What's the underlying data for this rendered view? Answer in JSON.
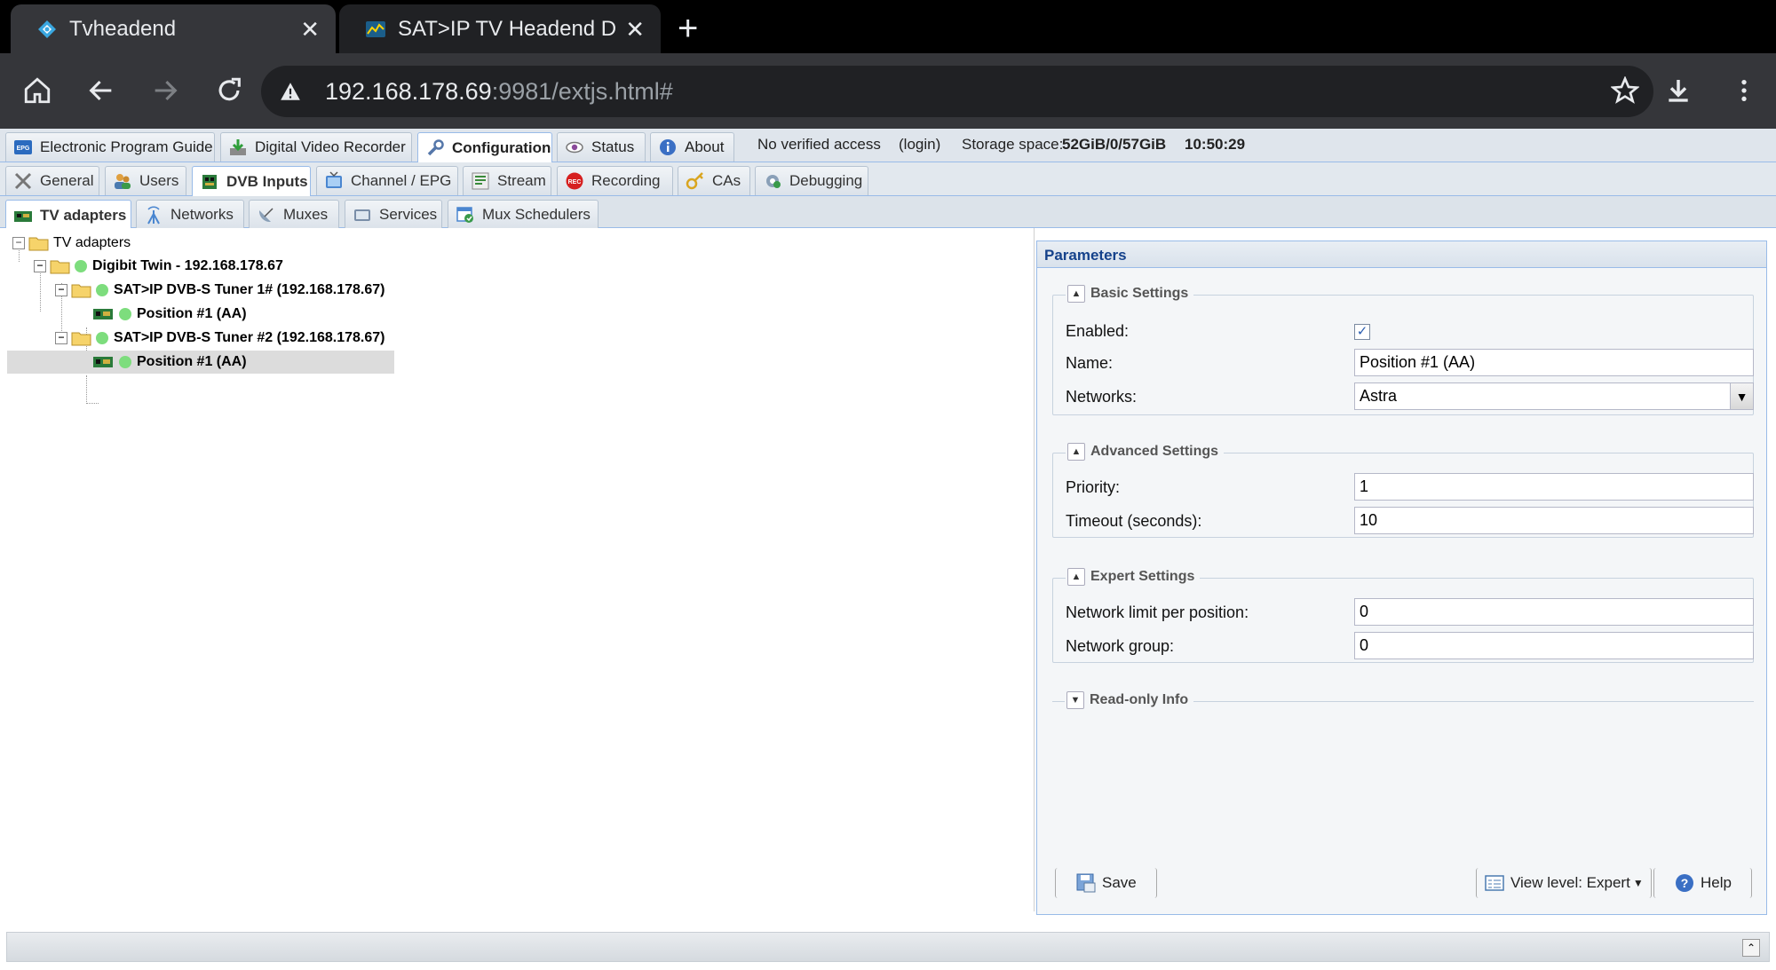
{
  "browser": {
    "tabs": [
      {
        "title": "Tvheadend",
        "active": true
      },
      {
        "title": "SAT>IP TV Headend DVB-",
        "active": false
      }
    ],
    "url_host": "192.168.178.69",
    "url_path": ":9981/extjs.html#"
  },
  "main_tabs": [
    {
      "label": "Electronic Program Guide",
      "icon": "epg-icon"
    },
    {
      "label": "Digital Video Recorder",
      "icon": "dvr-icon"
    },
    {
      "label": "Configuration",
      "icon": "wrench-icon",
      "selected": true
    },
    {
      "label": "Status",
      "icon": "eye-icon"
    },
    {
      "label": "About",
      "icon": "info-icon"
    }
  ],
  "status_info": {
    "access": "No verified access",
    "login": "(login)",
    "storage_label": "Storage space:",
    "storage_value": "52GiB/0/57GiB",
    "time": "10:50:29"
  },
  "config_tabs": [
    {
      "label": "General"
    },
    {
      "label": "Users"
    },
    {
      "label": "DVB Inputs",
      "selected": true
    },
    {
      "label": "Channel / EPG"
    },
    {
      "label": "Stream"
    },
    {
      "label": "Recording"
    },
    {
      "label": "CAs"
    },
    {
      "label": "Debugging"
    }
  ],
  "dvb_tabs": [
    {
      "label": "TV adapters",
      "selected": true
    },
    {
      "label": "Networks"
    },
    {
      "label": "Muxes"
    },
    {
      "label": "Services"
    },
    {
      "label": "Mux Schedulers"
    }
  ],
  "tree": {
    "root": "TV adapters",
    "device": "Digibit Twin - 192.168.178.67",
    "tuner1": "SAT>IP DVB-S Tuner 1# (192.168.178.67)",
    "tuner1_pos": "Position #1 (AA)",
    "tuner2": "SAT>IP DVB-S Tuner #2 (192.168.178.67)",
    "tuner2_pos": "Position #1 (AA)"
  },
  "params": {
    "title": "Parameters",
    "basic": {
      "legend": "Basic Settings",
      "enabled_label": "Enabled:",
      "enabled": true,
      "name_label": "Name:",
      "name_value": "Position #1 (AA)",
      "networks_label": "Networks:",
      "networks_value": "Astra"
    },
    "advanced": {
      "legend": "Advanced Settings",
      "priority_label": "Priority:",
      "priority_value": "1",
      "timeout_label": "Timeout (seconds):",
      "timeout_value": "10"
    },
    "expert": {
      "legend": "Expert Settings",
      "netlimit_label": "Network limit per position:",
      "netlimit_value": "0",
      "netgroup_label": "Network group:",
      "netgroup_value": "0"
    },
    "readonly_legend": "Read-only Info",
    "save_label": "Save",
    "viewlevel_label": "View level: Expert",
    "help_label": "Help"
  },
  "colors": {
    "accent": "#15428b",
    "status_dot": "#7ddd7d",
    "panel_border": "#99bbe8"
  }
}
